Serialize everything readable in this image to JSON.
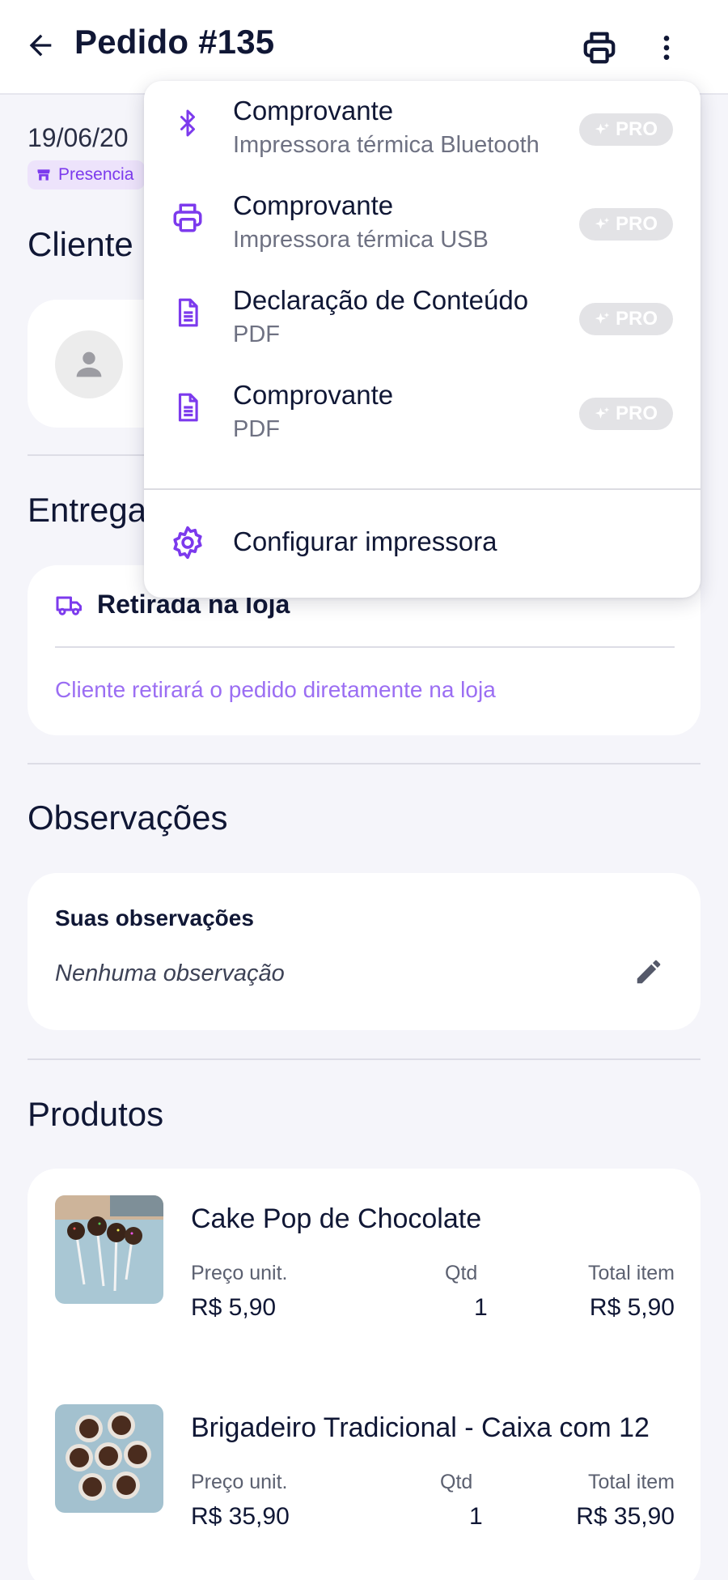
{
  "header": {
    "title": "Pedido #135"
  },
  "order": {
    "date": "19/06/20",
    "channel": "Presencia"
  },
  "sections": {
    "client": "Cliente",
    "delivery": "Entrega",
    "observations": "Observações",
    "products": "Produtos"
  },
  "delivery": {
    "method": "Retirada na loja",
    "note": "Cliente retirará o pedido diretamente na loja"
  },
  "observations": {
    "label": "Suas observações",
    "value": "Nenhuma observação"
  },
  "products": [
    {
      "name": "Cake Pop de Chocolate",
      "price_label": "Preço unit.",
      "qty_label": "Qtd",
      "total_label": "Total item",
      "price": "R$ 5,90",
      "qty": "1",
      "total": "R$ 5,90"
    },
    {
      "name": "Brigadeiro Tradicional - Caixa com 12",
      "price_label": "Preço unit.",
      "qty_label": "Qtd",
      "total_label": "Total item",
      "price": "R$ 35,90",
      "qty": "1",
      "total": "R$ 35,90"
    }
  ],
  "print_menu": {
    "items": [
      {
        "title": "Comprovante",
        "subtitle": "Impressora térmica Bluetooth",
        "badge": "PRO",
        "icon": "bluetooth-icon"
      },
      {
        "title": "Comprovante",
        "subtitle": "Impressora térmica USB",
        "badge": "PRO",
        "icon": "printer-icon"
      },
      {
        "title": "Declaração de Conteúdo",
        "subtitle": "PDF",
        "badge": "PRO",
        "icon": "document-icon"
      },
      {
        "title": "Comprovante",
        "subtitle": "PDF",
        "badge": "PRO",
        "icon": "document-icon"
      }
    ],
    "config_label": "Configurar impressora"
  },
  "colors": {
    "accent": "#7c3aed",
    "accent_light": "#9b6ef3",
    "text": "#101735",
    "background": "#f5f5fa"
  }
}
